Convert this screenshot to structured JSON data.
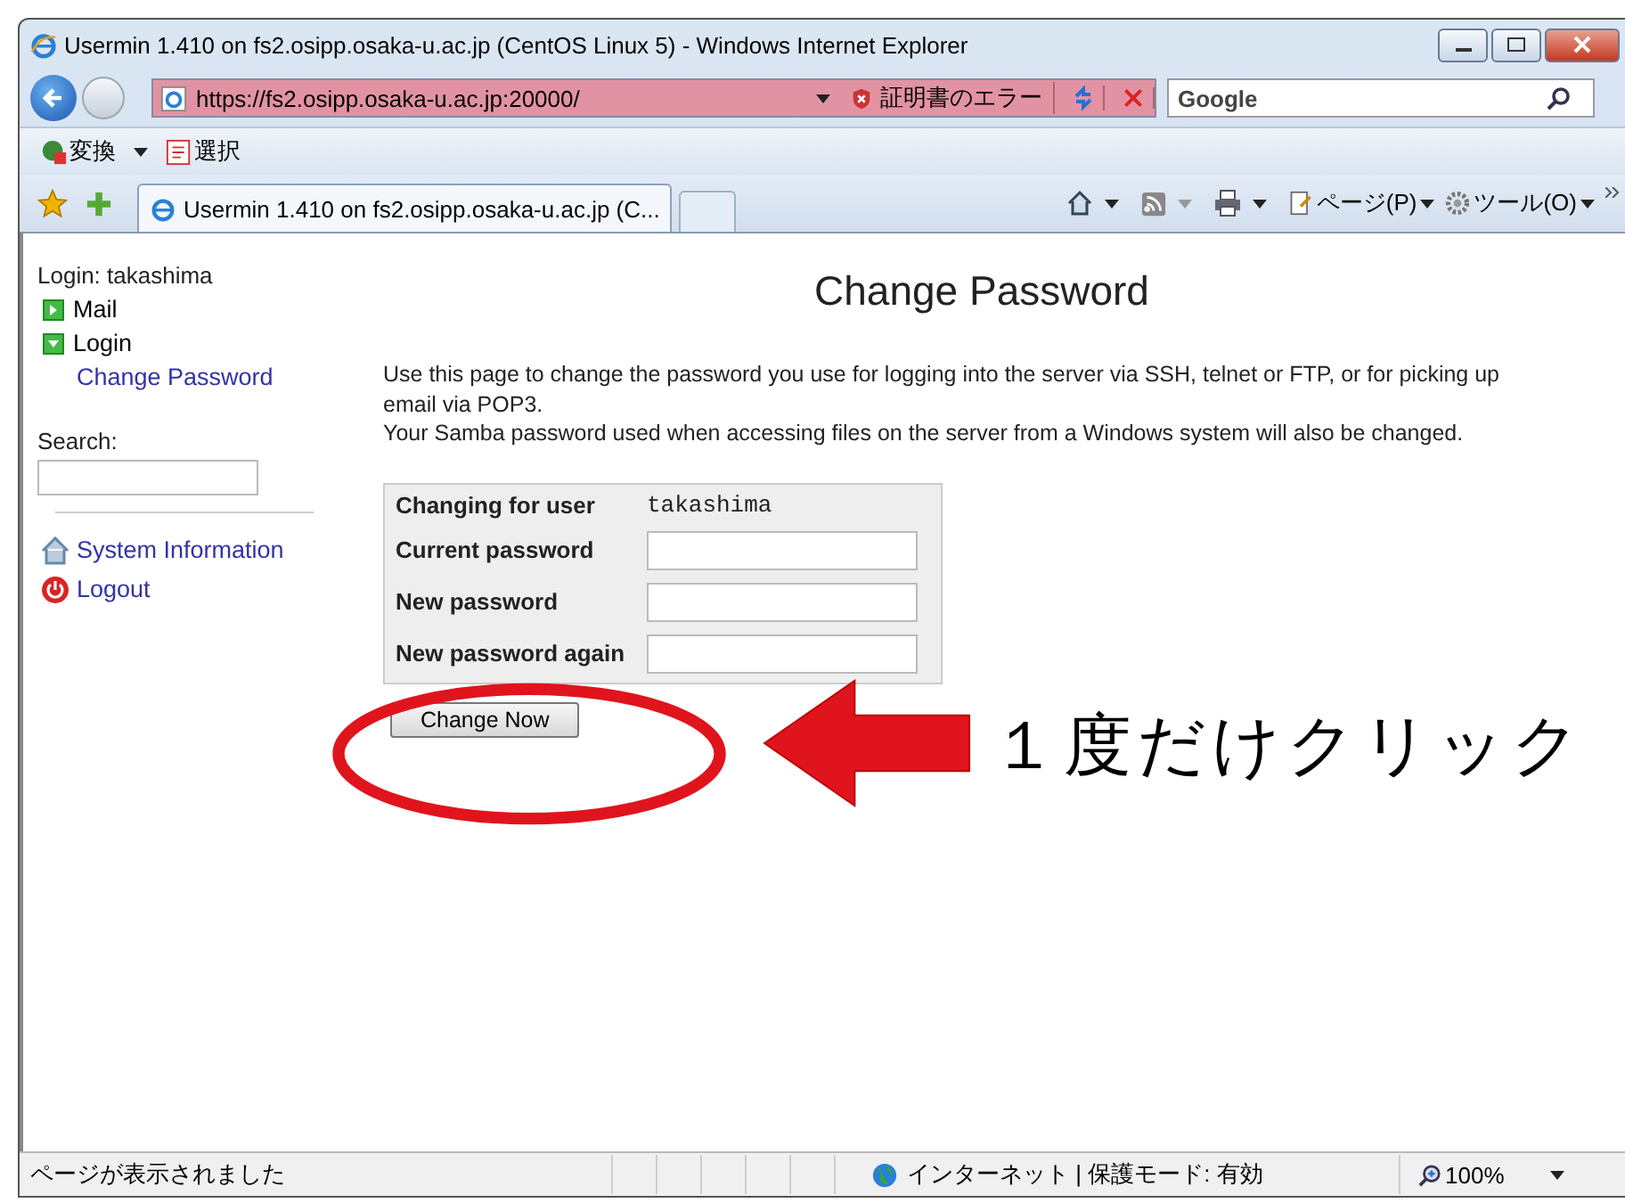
{
  "window": {
    "title": "Usermin 1.410 on fs2.osipp.osaka-u.ac.jp (CentOS Linux 5) - Windows Internet Explorer"
  },
  "address_bar": {
    "url": "https://fs2.osipp.osaka-u.ac.jp:20000/",
    "certificate_error": "証明書のエラー"
  },
  "search": {
    "value": "Google"
  },
  "toolbar": {
    "items": [
      "変換",
      "選択"
    ]
  },
  "tabs": [
    {
      "label": "Usermin 1.410 on fs2.osipp.osaka-u.ac.jp (C...",
      "selected": true
    }
  ],
  "command_bar": {
    "page": "ページ(P)",
    "tools": "ツール(O)"
  },
  "sidebar": {
    "login": "Login: takashima",
    "menu": [
      {
        "label": "Mail",
        "expanded": false
      },
      {
        "label": "Login",
        "expanded": true,
        "children": [
          {
            "label": "Change Password"
          }
        ]
      }
    ],
    "search_label": "Search:",
    "links": [
      {
        "kind": "home",
        "label": "System Information"
      },
      {
        "kind": "power",
        "label": "Logout"
      }
    ]
  },
  "page": {
    "title": "Change Password",
    "description": [
      "Use this page to change the password you use for logging into the server via SSH, telnet or FTP, or for picking up email via POP3.",
      "Your Samba password used when accessing files on the server from a Windows system will also be changed."
    ],
    "user_label": "Changing for user",
    "user": "takashima",
    "fields": [
      {
        "label": "Current password"
      },
      {
        "label": "New password"
      },
      {
        "label": "New password again"
      }
    ],
    "button": "Change Now"
  },
  "annotation": {
    "text": "１度だけクリック"
  },
  "status_bar": {
    "message": "ページが表示されました",
    "zone": "インターネット | 保護モード: 有効",
    "zoom": "100%"
  }
}
